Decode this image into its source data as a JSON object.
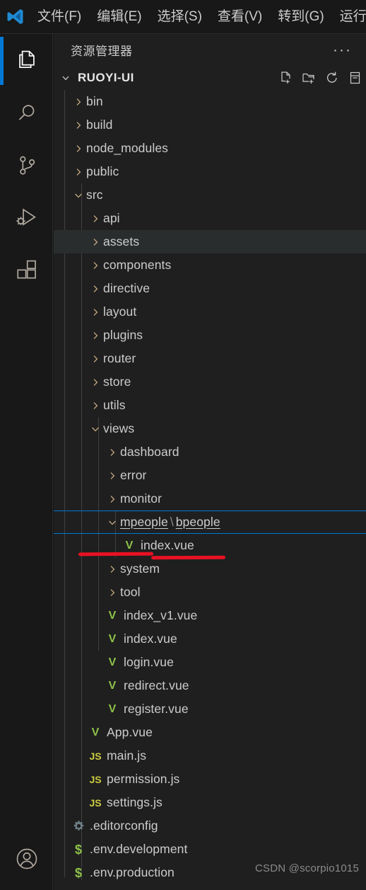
{
  "window": {
    "logo_icon": "vscode-logo-icon",
    "menus": [
      {
        "label": "文件(F)"
      },
      {
        "label": "编辑(E)"
      },
      {
        "label": "选择(S)"
      },
      {
        "label": "查看(V)"
      },
      {
        "label": "转到(G)"
      },
      {
        "label": "运行"
      }
    ]
  },
  "activity_bar": {
    "items": [
      {
        "name": "explorer",
        "icon": "files-icon",
        "active": true
      },
      {
        "name": "search",
        "icon": "search-icon",
        "active": false
      },
      {
        "name": "source-control",
        "icon": "source-control-icon",
        "active": false
      },
      {
        "name": "run-debug",
        "icon": "run-and-debug-icon",
        "active": false
      },
      {
        "name": "extensions",
        "icon": "extensions-icon",
        "active": false
      }
    ],
    "account": {
      "name": "account",
      "icon": "account-icon"
    }
  },
  "sidebar": {
    "title": "资源管理器",
    "more_actions_label": "···",
    "root_folder": {
      "name": "RUOYI-UI",
      "expanded": true,
      "actions": [
        {
          "name": "new-file",
          "icon": "new-file-icon"
        },
        {
          "name": "new-folder",
          "icon": "new-folder-icon"
        },
        {
          "name": "refresh",
          "icon": "refresh-icon"
        },
        {
          "name": "collapse-all",
          "icon": "collapse-all-icon"
        }
      ]
    }
  },
  "tree": {
    "rows": [
      {
        "label": "bin",
        "depth": 1,
        "kind": "folder",
        "expanded": false
      },
      {
        "label": "build",
        "depth": 1,
        "kind": "folder",
        "expanded": false
      },
      {
        "label": "node_modules",
        "depth": 1,
        "kind": "folder",
        "expanded": false
      },
      {
        "label": "public",
        "depth": 1,
        "kind": "folder",
        "expanded": false
      },
      {
        "label": "src",
        "depth": 1,
        "kind": "folder",
        "expanded": true
      },
      {
        "label": "api",
        "depth": 2,
        "kind": "folder",
        "expanded": false
      },
      {
        "label": "assets",
        "depth": 2,
        "kind": "folder",
        "expanded": false,
        "hovered": true
      },
      {
        "label": "components",
        "depth": 2,
        "kind": "folder",
        "expanded": false
      },
      {
        "label": "directive",
        "depth": 2,
        "kind": "folder",
        "expanded": false
      },
      {
        "label": "layout",
        "depth": 2,
        "kind": "folder",
        "expanded": false
      },
      {
        "label": "plugins",
        "depth": 2,
        "kind": "folder",
        "expanded": false
      },
      {
        "label": "router",
        "depth": 2,
        "kind": "folder",
        "expanded": false
      },
      {
        "label": "store",
        "depth": 2,
        "kind": "folder",
        "expanded": false
      },
      {
        "label": "utils",
        "depth": 2,
        "kind": "folder",
        "expanded": false
      },
      {
        "label": "views",
        "depth": 2,
        "kind": "folder",
        "expanded": true
      },
      {
        "label": "dashboard",
        "depth": 3,
        "kind": "folder",
        "expanded": false
      },
      {
        "label": "error",
        "depth": 3,
        "kind": "folder",
        "expanded": false
      },
      {
        "label": "monitor",
        "depth": 3,
        "kind": "folder",
        "expanded": false
      },
      {
        "label": "mpeople",
        "label2": "bpeople",
        "depth": 3,
        "kind": "folder",
        "expanded": true,
        "selected": true,
        "underlined": true
      },
      {
        "label": "index.vue",
        "depth": 4,
        "kind": "vue"
      },
      {
        "label": "system",
        "depth": 3,
        "kind": "folder",
        "expanded": false
      },
      {
        "label": "tool",
        "depth": 3,
        "kind": "folder",
        "expanded": false
      },
      {
        "label": "index_v1.vue",
        "depth": 3,
        "kind": "vue"
      },
      {
        "label": "index.vue",
        "depth": 3,
        "kind": "vue"
      },
      {
        "label": "login.vue",
        "depth": 3,
        "kind": "vue"
      },
      {
        "label": "redirect.vue",
        "depth": 3,
        "kind": "vue"
      },
      {
        "label": "register.vue",
        "depth": 3,
        "kind": "vue"
      },
      {
        "label": "App.vue",
        "depth": 2,
        "kind": "vue"
      },
      {
        "label": "main.js",
        "depth": 2,
        "kind": "js"
      },
      {
        "label": "permission.js",
        "depth": 2,
        "kind": "js"
      },
      {
        "label": "settings.js",
        "depth": 2,
        "kind": "js"
      },
      {
        "label": ".editorconfig",
        "depth": 1,
        "kind": "config"
      },
      {
        "label": ".env.development",
        "depth": 1,
        "kind": "env"
      },
      {
        "label": ".env.production",
        "depth": 1,
        "kind": "env"
      }
    ]
  },
  "annotation": {
    "type": "red-underline",
    "target": "mpeople \\ bpeople"
  },
  "watermark": {
    "text": "CSDN @scorpio1015"
  },
  "colors": {
    "accent_blue": "#0078d4",
    "annotation_red": "#e81123",
    "sidebar_bg": "#1f1f1f",
    "activitybar_bg": "#181818",
    "row_hover": "#2a2d2e",
    "text": "#cccccc",
    "vue_green": "#8dc149",
    "js_yellow": "#cbcb41"
  }
}
